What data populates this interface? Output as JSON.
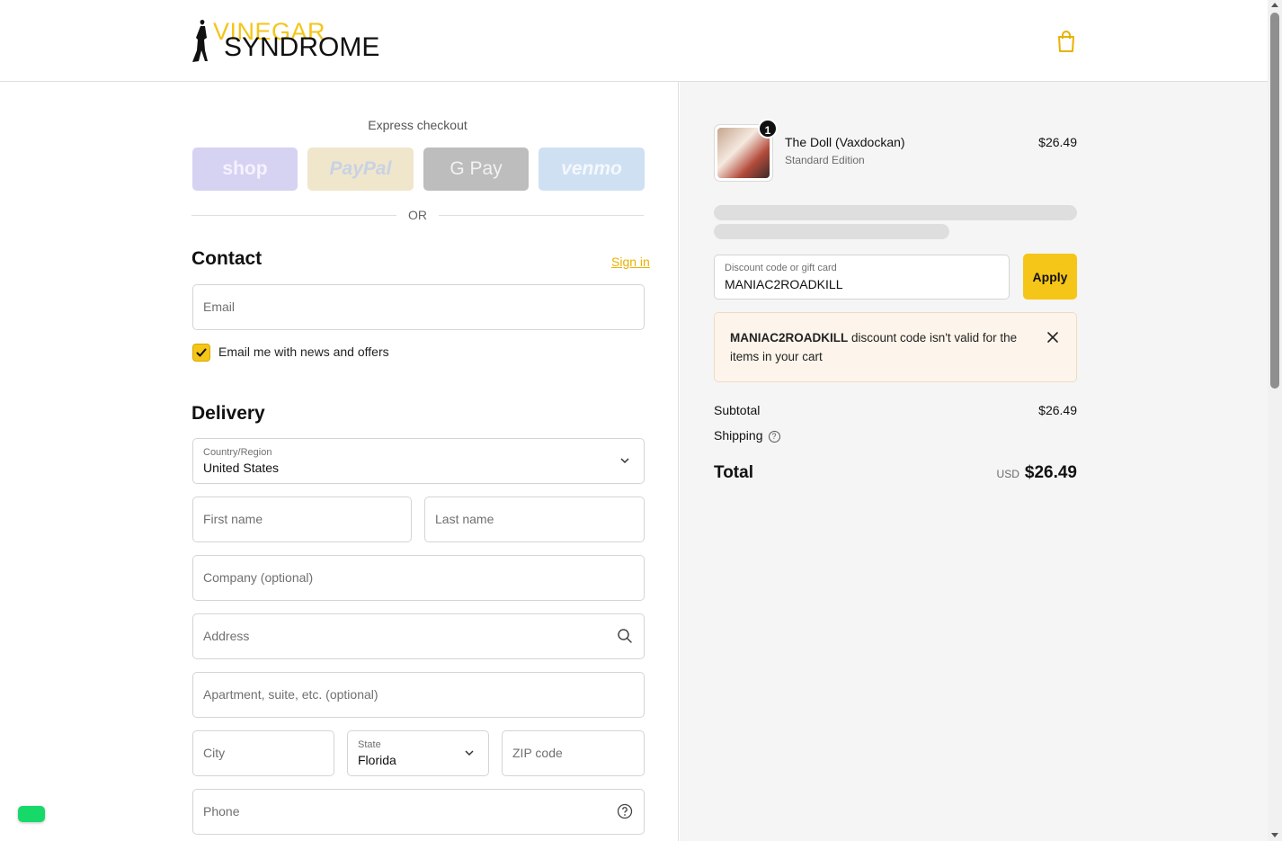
{
  "header": {
    "logo_top": "VINEGAR",
    "logo_bottom": "SYNDROME"
  },
  "express": {
    "label": "Express checkout",
    "shop": "shop",
    "paypal": "PayPal",
    "gpay": "G Pay",
    "venmo": "venmo",
    "or": "OR"
  },
  "contact": {
    "title": "Contact",
    "signin": "Sign in",
    "email_placeholder": "Email",
    "newsletter_label": "Email me with news and offers",
    "newsletter_checked": true
  },
  "delivery": {
    "title": "Delivery",
    "country_label": "Country/Region",
    "country_value": "United States",
    "first_name": "First name",
    "last_name": "Last name",
    "company": "Company (optional)",
    "address": "Address",
    "apartment": "Apartment, suite, etc. (optional)",
    "city": "City",
    "state_label": "State",
    "state_value": "Florida",
    "zip": "ZIP code",
    "phone": "Phone"
  },
  "summary": {
    "product_name": "The Doll (Vaxdockan)",
    "product_edition": "Standard Edition",
    "product_price": "$26.49",
    "quantity": "1",
    "discount_label": "Discount code or gift card",
    "discount_value": "MANIAC2ROADKILL",
    "apply": "Apply",
    "error_code": "MANIAC2ROADKILL",
    "error_text": " discount code isn't valid for the items in your cart",
    "subtotal_label": "Subtotal",
    "subtotal_value": "$26.49",
    "shipping_label": "Shipping",
    "total_label": "Total",
    "total_currency": "USD",
    "total_value": "$26.49"
  },
  "colors": {
    "accent": "#f5c518"
  }
}
